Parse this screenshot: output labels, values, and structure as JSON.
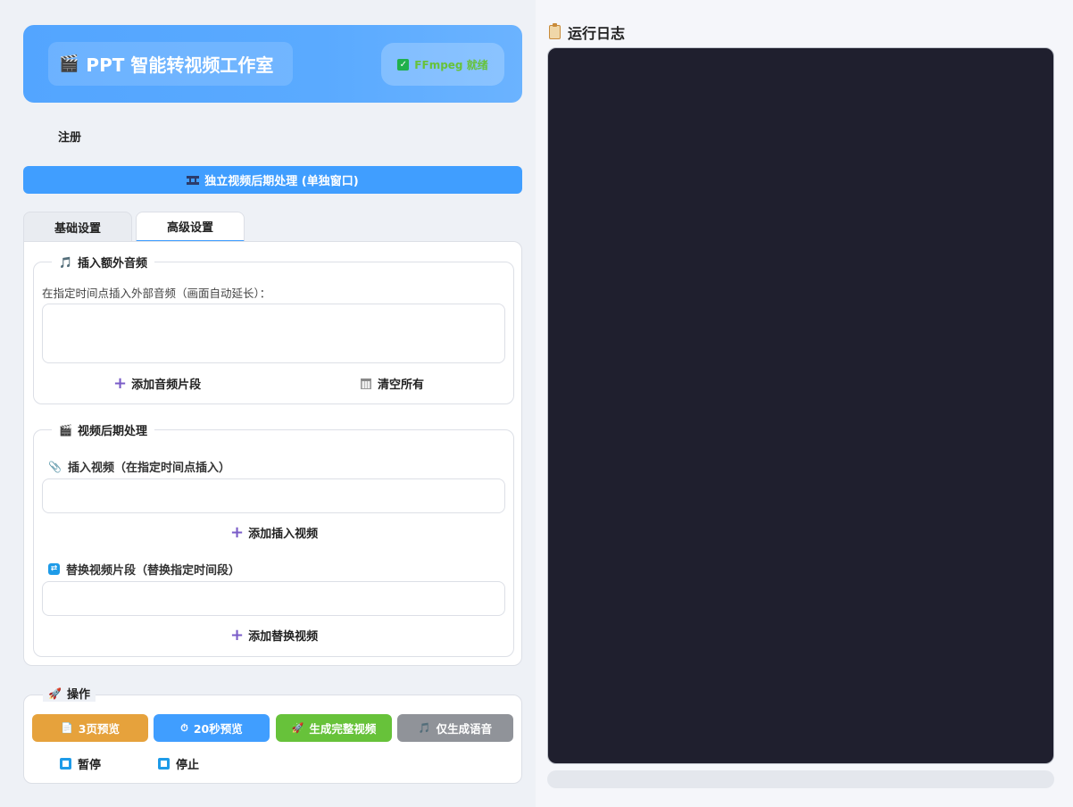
{
  "header": {
    "title": "PPT 智能转视频工作室",
    "ffmpeg_status": "FFmpeg 就绪",
    "title_icon": "clapper-icon",
    "status_icon": "check-icon"
  },
  "register_link": "注册",
  "post_process_button": "独立视频后期处理 (单独窗口)",
  "tabs": [
    {
      "label": "基础设置",
      "active": false
    },
    {
      "label": "高级设置",
      "active": true
    }
  ],
  "audio_group": {
    "legend": "插入额外音频",
    "description": "在指定时间点插入外部音频（画面自动延长）：",
    "add_label": "添加音频片段",
    "clear_label": "清空所有"
  },
  "video_group": {
    "legend": "视频后期处理",
    "insert_label": "插入视频（在指定时间点插入）",
    "add_insert_label": "添加插入视频",
    "replace_label": "替换视频片段（替换指定时间段）",
    "add_replace_label": "添加替换视频"
  },
  "operations": {
    "legend": "操作",
    "buttons": [
      {
        "label": "3页预览",
        "color": "#e6a23c"
      },
      {
        "label": "20秒预览",
        "color": "#409eff"
      },
      {
        "label": "生成完整视频",
        "color": "#67c23a"
      },
      {
        "label": "仅生成语音",
        "color": "#909399"
      }
    ],
    "pause_label": "暂停",
    "stop_label": "停止"
  },
  "log": {
    "title": "运行日志",
    "progress": 0
  }
}
